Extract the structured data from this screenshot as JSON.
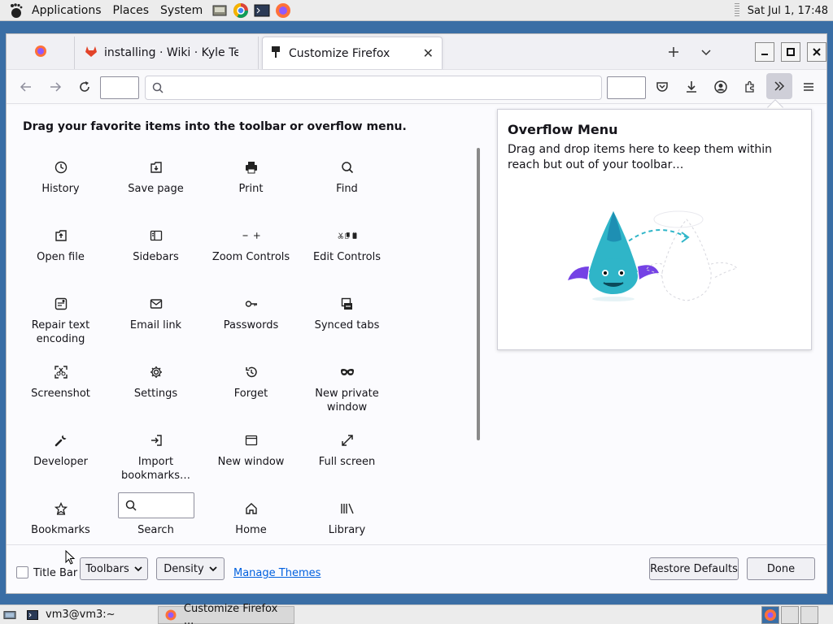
{
  "top_panel": {
    "menus": [
      "Applications",
      "Places",
      "System"
    ],
    "clock": "Sat Jul  1, 17:48"
  },
  "tabs": {
    "tab2_title": "installing · Wiki · Kyle Terrien",
    "tab3_title": "Customize Firefox",
    "new_tab_icon": "plus-icon",
    "list_all_tabs_icon": "chevron-down-icon"
  },
  "customize": {
    "header": "Drag your favorite items into the toolbar or overflow menu.",
    "items": [
      {
        "label": "History",
        "icon": "clock-icon"
      },
      {
        "label": "Save page",
        "icon": "save-page-icon"
      },
      {
        "label": "Print",
        "icon": "printer-icon"
      },
      {
        "label": "Find",
        "icon": "magnifier-icon"
      },
      {
        "label": "Open file",
        "icon": "open-file-icon"
      },
      {
        "label": "Sidebars",
        "icon": "sidebar-icon"
      },
      {
        "label": "Zoom Controls",
        "icon": "zoom-icon"
      },
      {
        "label": "Edit Controls",
        "icon": "edit-icon"
      },
      {
        "label": "Repair text encoding",
        "icon": "text-encoding-icon"
      },
      {
        "label": "Email link",
        "icon": "envelope-icon"
      },
      {
        "label": "Passwords",
        "icon": "key-icon"
      },
      {
        "label": "Synced tabs",
        "icon": "synced-tabs-icon"
      },
      {
        "label": "Screenshot",
        "icon": "screenshot-icon"
      },
      {
        "label": "Settings",
        "icon": "gear-icon"
      },
      {
        "label": "Forget",
        "icon": "forget-icon"
      },
      {
        "label": "New private window",
        "icon": "mask-icon"
      },
      {
        "label": "Developer",
        "icon": "wrench-icon"
      },
      {
        "label": "Import bookmarks…",
        "icon": "import-icon"
      },
      {
        "label": "New window",
        "icon": "window-icon"
      },
      {
        "label": "Full screen",
        "icon": "fullscreen-icon"
      },
      {
        "label": "Bookmarks",
        "icon": "star-icon"
      },
      {
        "label": "Search",
        "icon": "search-box"
      },
      {
        "label": "Home",
        "icon": "home-icon"
      },
      {
        "label": "Library",
        "icon": "library-icon"
      }
    ],
    "overflow_title": "Overflow Menu",
    "overflow_desc": "Drag and drop items here to keep them within reach but out of your toolbar…"
  },
  "footer": {
    "title_bar_label": "Title Bar",
    "title_bar_checked": false,
    "toolbars_label": "Toolbars",
    "density_label": "Density",
    "manage_themes": "Manage Themes",
    "restore_defaults": "Restore Defaults",
    "done": "Done"
  },
  "taskbar": {
    "items": [
      "vm3@vm3:~",
      "Customize Firefox ..."
    ]
  }
}
